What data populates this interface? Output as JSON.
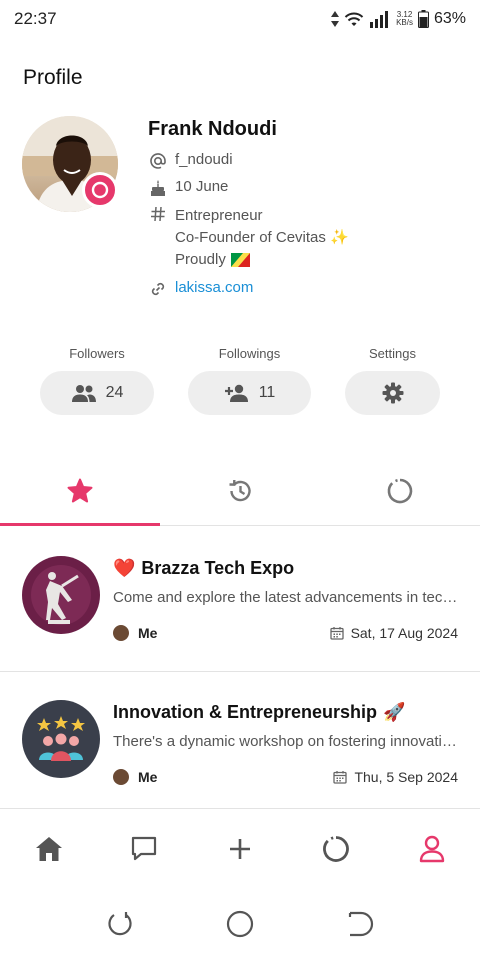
{
  "status_bar": {
    "time": "22:37",
    "network_speed": "3.12",
    "network_unit": "KB/s",
    "battery": "63%"
  },
  "page": {
    "title": "Profile"
  },
  "profile": {
    "name": "Frank Ndoudi",
    "username": "f_ndoudi",
    "birthday": "10 June",
    "bio_lines": [
      "Entrepreneur",
      "Co-Founder of Cevitas ✨",
      "Proudly"
    ],
    "website": "lakissa.com",
    "accent": "#e6386b"
  },
  "stats": {
    "followers": {
      "label": "Followers",
      "count": "24",
      "icon": "people-icon"
    },
    "followings": {
      "label": "Followings",
      "count": "11",
      "icon": "person-add-icon"
    },
    "settings": {
      "label": "Settings",
      "icon": "gear-icon"
    }
  },
  "tabs": [
    {
      "icon": "star-icon",
      "active": true
    },
    {
      "icon": "history-icon",
      "active": false
    },
    {
      "icon": "loading-circle-icon",
      "active": false
    }
  ],
  "events": [
    {
      "emoji": "❤️",
      "title": "Brazza Tech Expo",
      "description": "Come and explore the latest advancements in technology at Brazza Tech Expo",
      "author": "Me",
      "date": "Sat, 17 Aug 2024"
    },
    {
      "title": "Innovation & Entrepreneurship",
      "emoji_after": "🚀",
      "description": "There's a dynamic workshop on fostering innovation and entrepreneurship",
      "author": "Me",
      "date": "Thu, 5 Sep 2024"
    }
  ],
  "bottom_nav": [
    "home-icon",
    "chat-icon",
    "plus-icon",
    "circle-icon",
    "profile-icon"
  ],
  "colors": {
    "accent": "#e6386b",
    "link": "#1a8fd6",
    "pill": "#eeeeee"
  }
}
